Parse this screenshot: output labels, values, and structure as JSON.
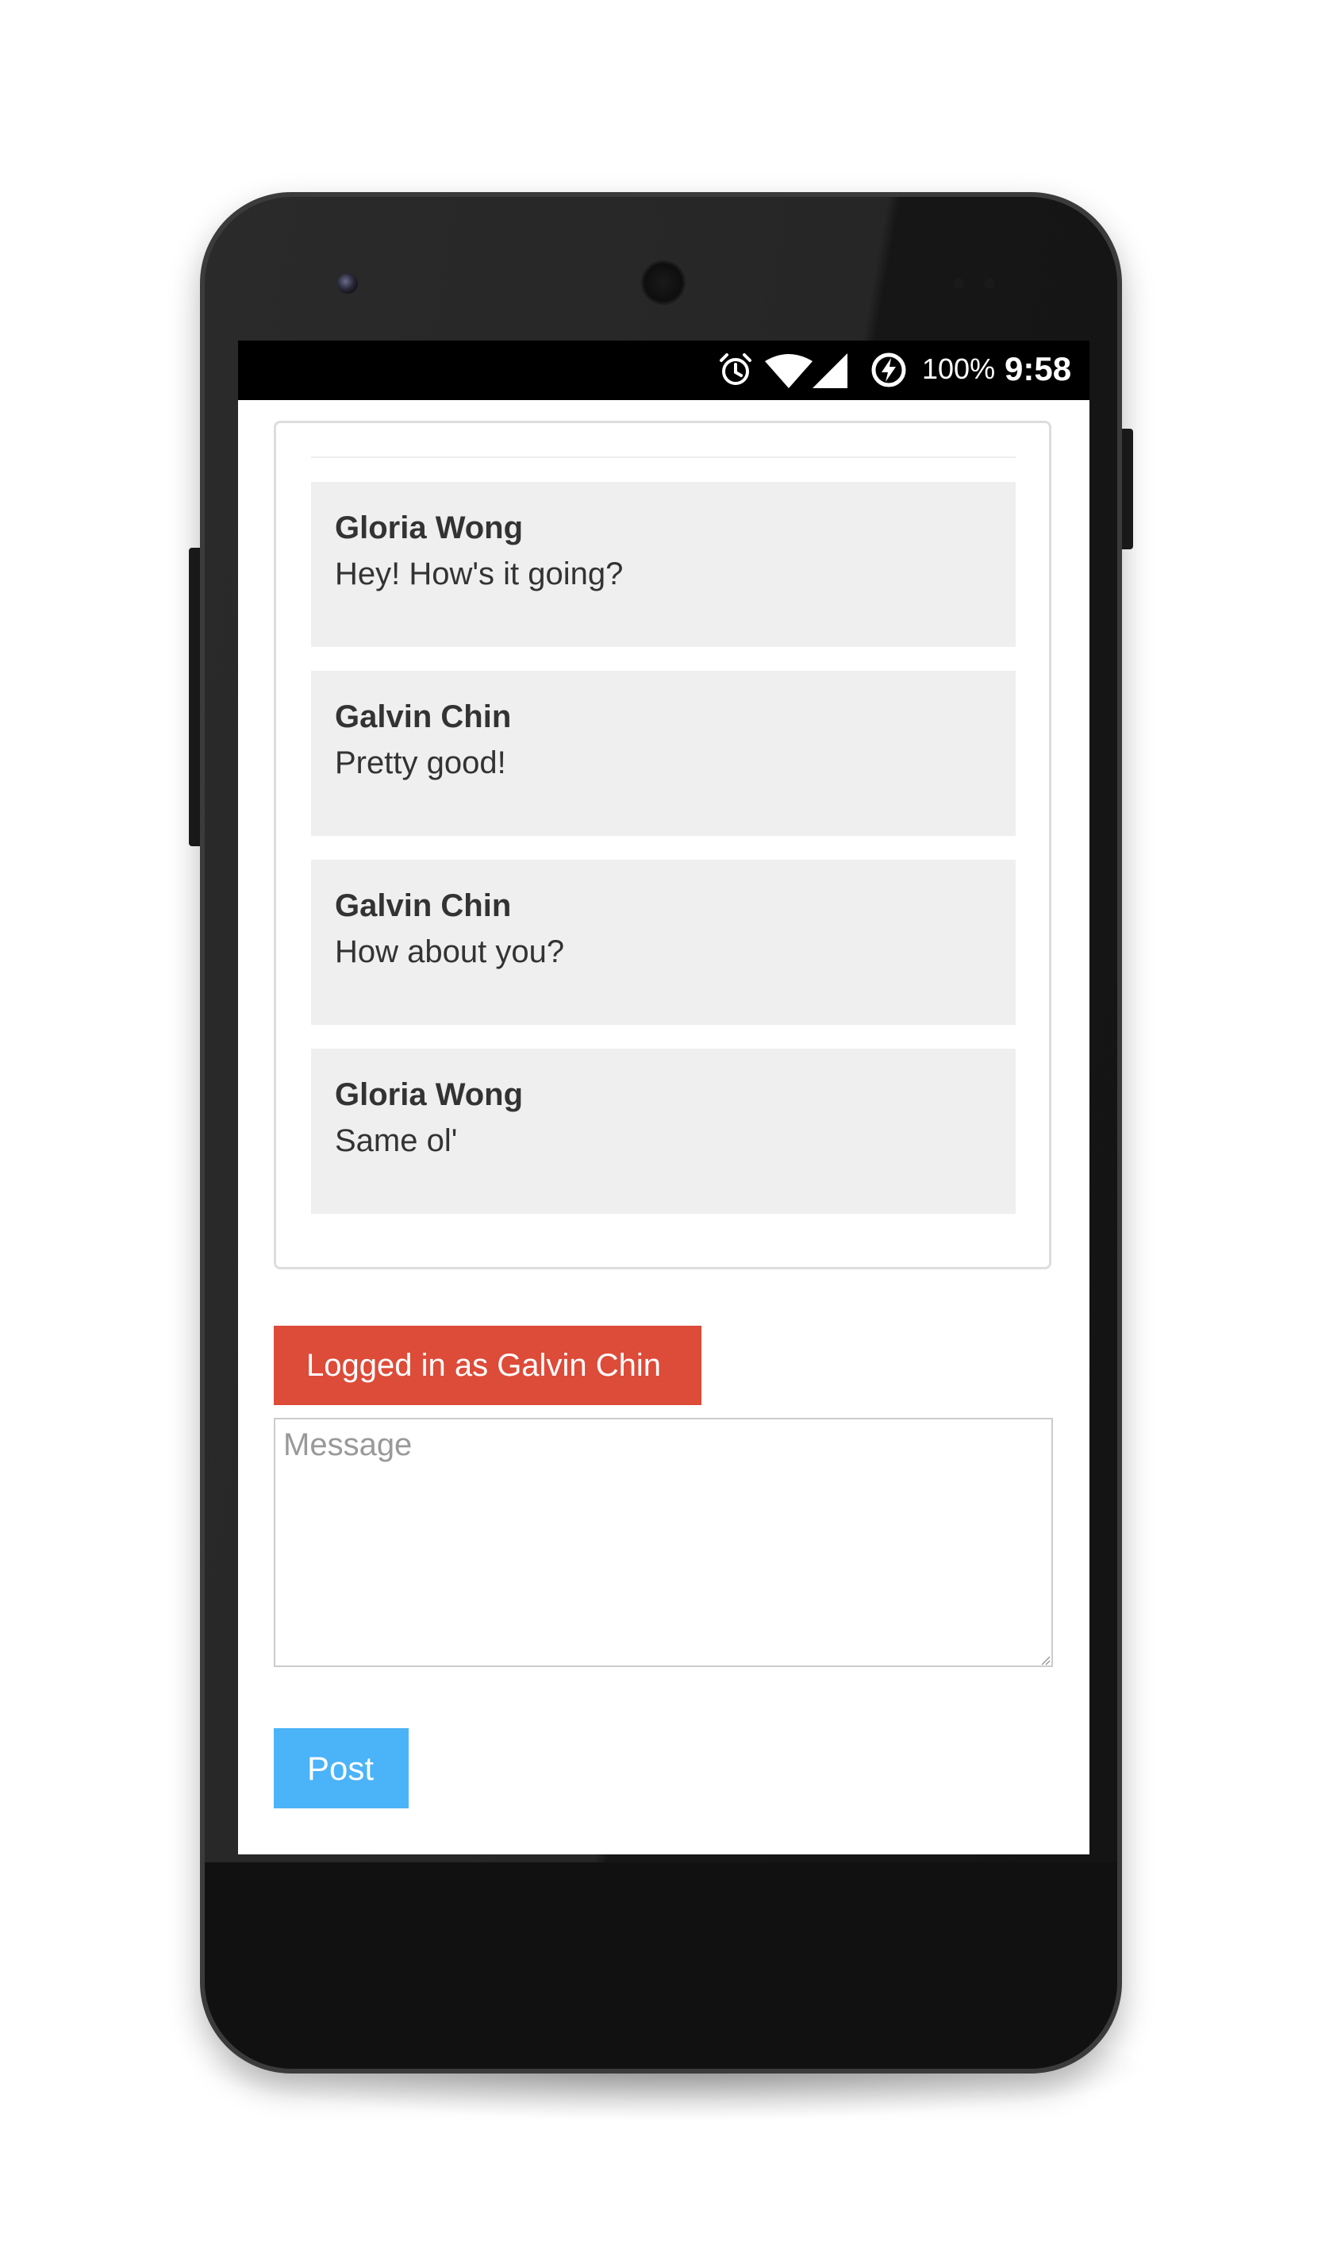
{
  "status_bar": {
    "battery_percent": "100%",
    "time": "9:58",
    "icons": [
      "alarm-icon",
      "wifi-icon",
      "signal-icon",
      "battery-charging-icon"
    ]
  },
  "chat": {
    "messages": [
      {
        "author": "Gloria Wong",
        "text": "Hey! How's it going?"
      },
      {
        "author": "Galvin Chin",
        "text": "Pretty good!"
      },
      {
        "author": "Galvin Chin",
        "text": "How about you?"
      },
      {
        "author": "Gloria Wong",
        "text": "Same ol'"
      }
    ]
  },
  "login": {
    "label": "Logged in as Galvin Chin"
  },
  "composer": {
    "placeholder": "Message",
    "value": ""
  },
  "post_button": {
    "label": "Post"
  },
  "colors": {
    "login_badge": "#dd4b39",
    "post_button": "#4bb3f7",
    "message_bg": "#efefef",
    "status_bar": "#000000"
  }
}
